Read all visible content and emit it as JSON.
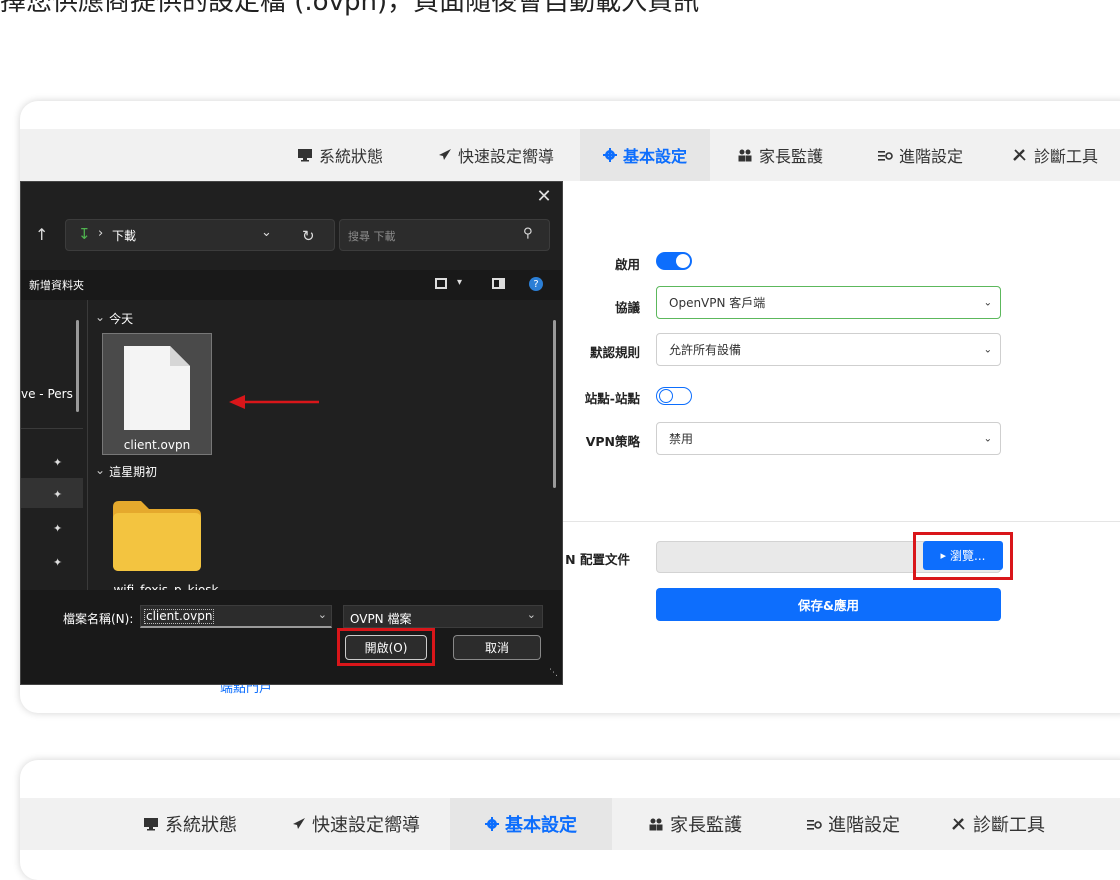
{
  "caption": "擇您供應商提供的設定檔 (.ovpn)，頁面隨後會自動載入資訊",
  "nav": {
    "items": [
      {
        "label": "系統狀態",
        "icon": "monitor-icon"
      },
      {
        "label": "快速設定嚮導",
        "icon": "rocket-icon"
      },
      {
        "label": "基本設定",
        "icon": "gear-icon",
        "active": true
      },
      {
        "label": "家長監護",
        "icon": "users-icon"
      },
      {
        "label": "進階設定",
        "icon": "sliders-icon"
      },
      {
        "label": "診斷工具",
        "icon": "tools-icon"
      }
    ]
  },
  "form": {
    "enable_label": "啟用",
    "protocol_label": "協議",
    "protocol_value": "OpenVPN 客戶端",
    "default_rule_label": "默認規則",
    "default_rule_value": "允許所有設備",
    "site_to_site_label": "站點-站點",
    "vpn_policy_label": "VPN策略",
    "vpn_policy_value": "禁用",
    "config_file_label": "N 配置文件",
    "browse_label": "瀏覽...",
    "save_label": "保存&應用",
    "partial_link": "端點門戶"
  },
  "dialog": {
    "breadcrumb_sep": "›",
    "location": "下載",
    "search_placeholder": "搜尋 下載",
    "new_folder": "新增資料夾",
    "group_today": "今天",
    "group_this_week": "這星期初",
    "file_name": "client.ovpn",
    "folder_partial_name": "wifi_foxjs_p_kiosk",
    "sidebar_partial": "ve - Pers",
    "filename_label": "檔案名稱(N):",
    "filename_value": "client.ovpn",
    "filetype_value": "OVPN 檔案",
    "open_label": "開啟(O)",
    "cancel_label": "取消"
  },
  "colors": {
    "accent": "#0d6efd",
    "highlight_red": "#d9161a",
    "dialog_bg": "#202020",
    "folder_yellow": "#f3c440"
  }
}
